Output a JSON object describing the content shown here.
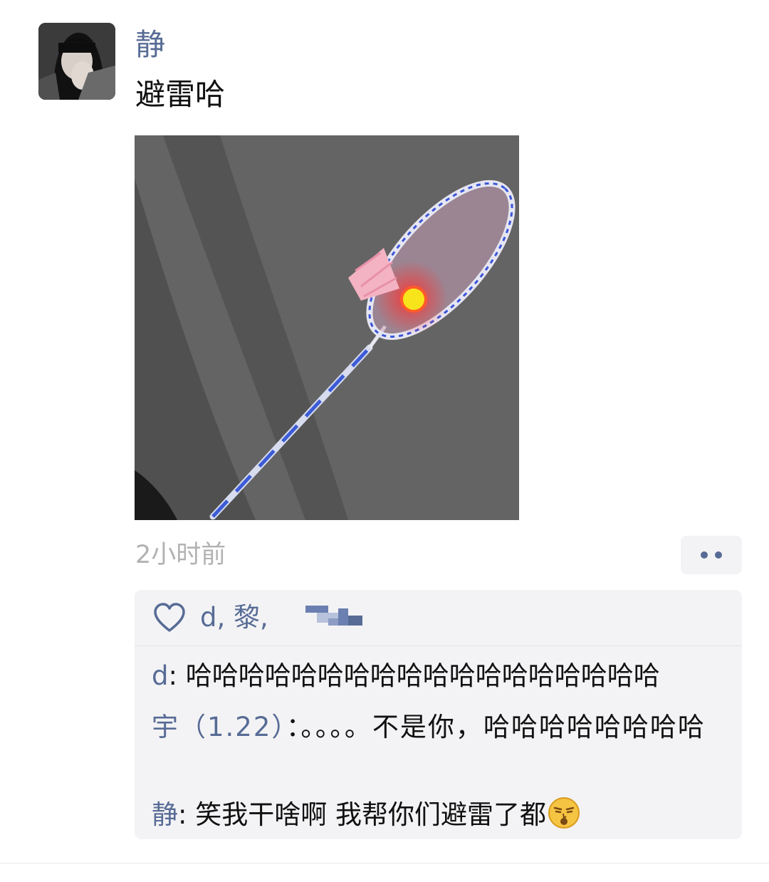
{
  "post": {
    "author": "静",
    "text": "避雷哈",
    "timestamp": "2小时前"
  },
  "likes": {
    "names": "d, 黎,"
  },
  "comments": [
    {
      "author": "d",
      "separator": ": ",
      "text": "哈哈哈哈哈哈哈哈哈哈哈哈哈哈哈哈哈哈"
    },
    {
      "author": "宇（1.22）",
      "separator": "：",
      "text": "。。。。不是你，哈哈哈哈哈哈哈哈"
    },
    {
      "author": "静",
      "separator": ": ",
      "text": "笑我干啥啊 我帮你们避雷了都"
    }
  ],
  "colors": {
    "link_blue": "#576b95",
    "timestamp_gray": "#b2b2b2",
    "box_background": "#f3f3f5"
  },
  "icons": {
    "like": "heart-icon",
    "more": "more-dots-icon",
    "emoji": "smirk-emoji-icon"
  }
}
